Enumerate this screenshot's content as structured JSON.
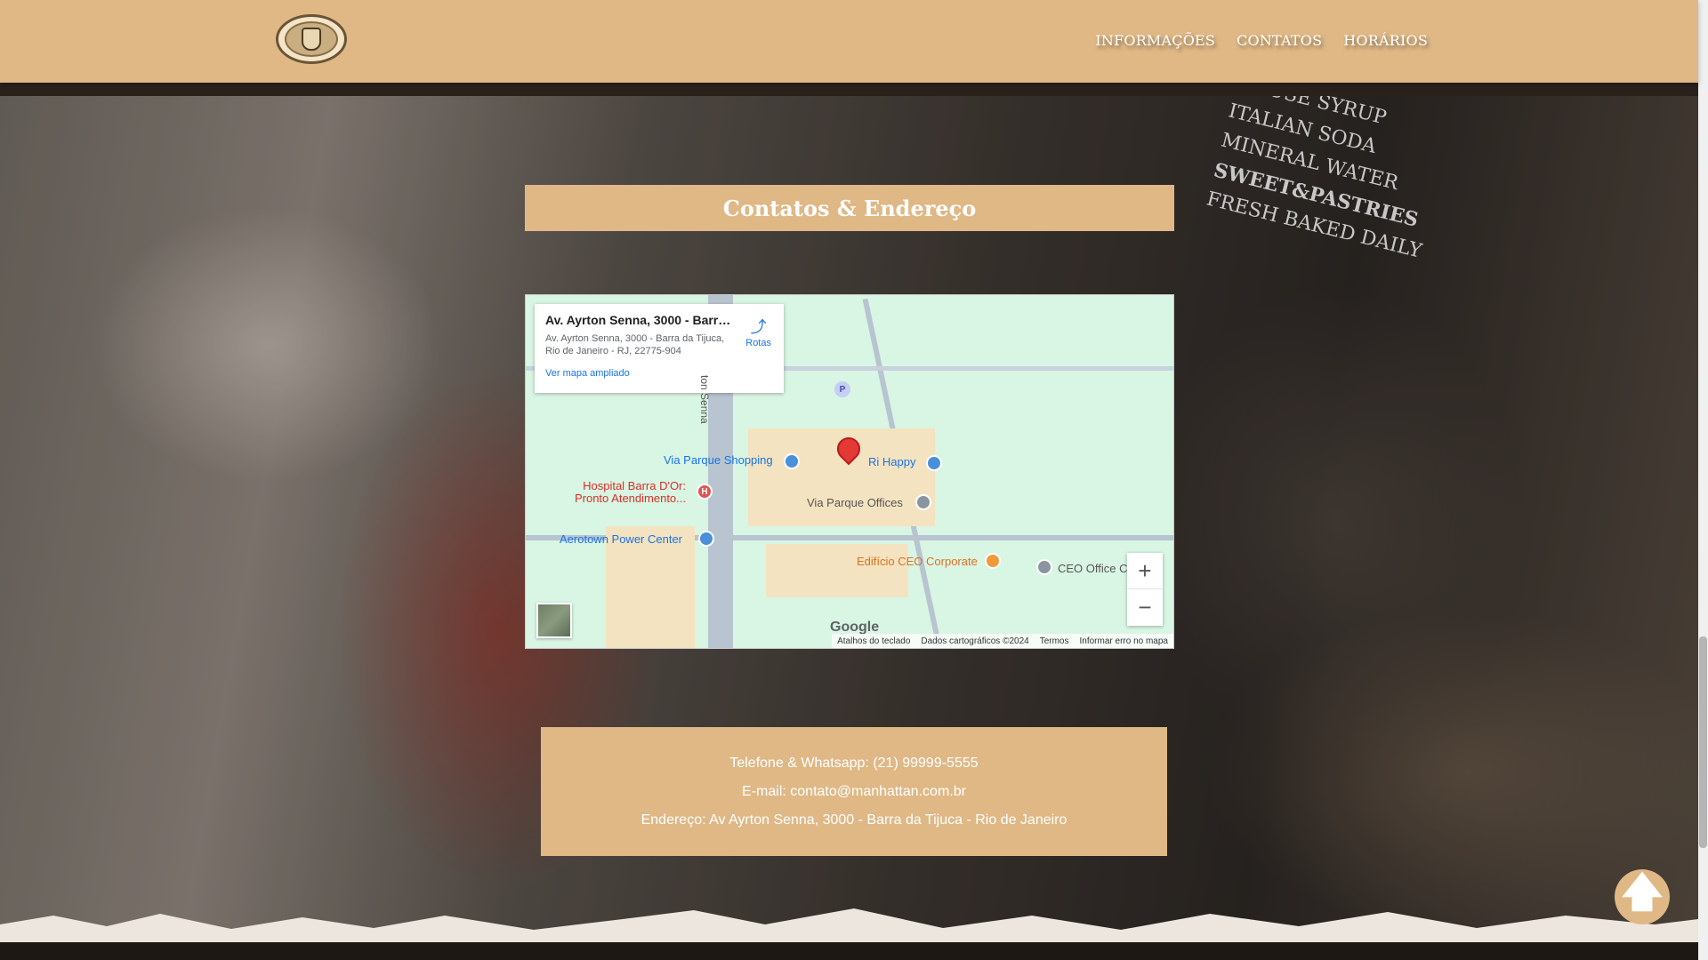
{
  "header": {
    "nav": [
      {
        "label": "INFORMAÇÕES"
      },
      {
        "label": "CONTATOS"
      },
      {
        "label": "HORÁRIOS"
      }
    ]
  },
  "background": {
    "chalkboard_lines": [
      "HOUSE SYRUP",
      "ITALIAN SODA",
      "MINERAL WATER",
      "SWEET&PASTRIES",
      "FRESH BAKED DAILY"
    ]
  },
  "section": {
    "title": "Contatos & Endereço"
  },
  "map": {
    "card": {
      "title": "Av. Ayrton Senna, 3000 - Barra...",
      "address": "Av. Ayrton Senna, 3000 - Barra da Tijuca, Rio de Janeiro - RJ, 22775-904",
      "directions_label": "Rotas",
      "larger_map_link": "Ver mapa ampliado"
    },
    "places": {
      "via_parque_shopping": "Via Parque Shopping",
      "ri_happy": "Ri Happy",
      "hospital": "Hospital Barra D'Or: Pronto Atendimento...",
      "via_parque_offices": "Via Parque Offices",
      "aerotown": "Aerotown Power Center",
      "ceo_corporate": "Edifício CEO Corporate",
      "ceo_office": "CEO Office C",
      "street": "ton Senna",
      "parking": "P"
    },
    "google_logo": "Google",
    "footer": {
      "shortcuts": "Atalhos do teclado",
      "map_data": "Dados cartográficos ©2024",
      "terms": "Termos",
      "report": "Informar erro no mapa"
    },
    "zoom_in": "+",
    "zoom_out": "−"
  },
  "contact": {
    "phone": "Telefone & Whatsapp: (21) 99999-5555",
    "email": "E-mail: contato@manhattan.com.br",
    "address": "Endereço: Av Ayrton Senna, 3000 - Barra da Tijuca - Rio de Janeiro"
  },
  "back_to_top": "🡅",
  "colors": {
    "accent": "#dfb886",
    "text_light": "#ffffff"
  }
}
